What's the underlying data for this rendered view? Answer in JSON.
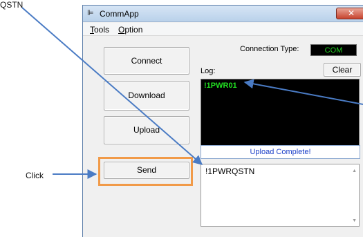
{
  "annotations": {
    "top_left": "QSTN",
    "click": "Click",
    "right_edge": ""
  },
  "window": {
    "title": "CommApp",
    "close_glyph": "✕"
  },
  "menu": {
    "items": [
      "Tools",
      "Option"
    ]
  },
  "buttons": {
    "connect": "Connect",
    "download": "Download",
    "upload": "Upload",
    "send": "Send",
    "clear": "Clear"
  },
  "connection": {
    "label": "Connection Type:",
    "value": "COM"
  },
  "log": {
    "label": "Log:",
    "lines": [
      "!1PWR01"
    ]
  },
  "status": {
    "message": "Upload Complete!"
  },
  "send_area": {
    "text": "!1PWRQSTN"
  },
  "colors": {
    "arrow": "#4a7bc4",
    "highlight": "#f19a48",
    "log_text": "#22e022",
    "status_text": "#1a3fc8"
  },
  "icons": {
    "title": "app-icon",
    "close": "close-icon",
    "scroll_up": "scroll-up-arrow-icon",
    "scroll_down": "scroll-down-arrow-icon"
  }
}
